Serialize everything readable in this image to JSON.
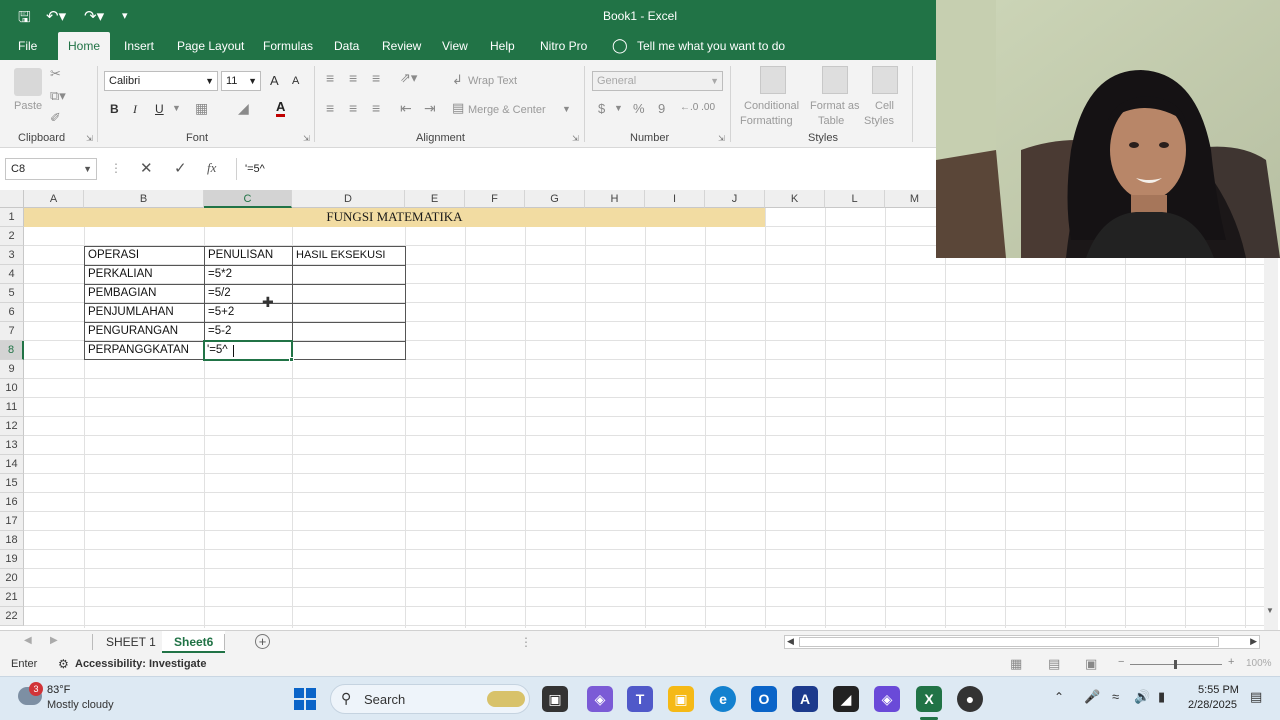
{
  "window": {
    "title": "Book1  -  Excel"
  },
  "ribbon_tabs": [
    "File",
    "Home",
    "Insert",
    "Page Layout",
    "Formulas",
    "Data",
    "Review",
    "View",
    "Help",
    "Nitro Pro"
  ],
  "active_tab": "Home",
  "tell_me": "Tell me what you want to do",
  "ribbon": {
    "clipboard": {
      "paste_label": "Paste",
      "group_label": "Clipboard"
    },
    "font": {
      "name": "Calibri",
      "size": "11",
      "grow": "A",
      "shrink": "A",
      "bold": "B",
      "italic": "I",
      "underline": "U",
      "color_letter": "A",
      "group_label": "Font"
    },
    "alignment": {
      "wrap_text": "Wrap Text",
      "merge_center": "Merge & Center",
      "group_label": "Alignment"
    },
    "number": {
      "format": "General",
      "currency": "$",
      "percent": "%",
      "comma": "9",
      "inc_decimal": "←.0 .00",
      "group_label": "Number"
    },
    "styles": {
      "conditional": "Conditional",
      "conditional2": "Formatting",
      "format_as": "Format as",
      "format_as2": "Table",
      "cell": "Cell",
      "cell2": "Styles",
      "group_label": "Styles"
    }
  },
  "formula_bar": {
    "name_box": "C8",
    "value": "'=5^"
  },
  "columns": [
    "A",
    "B",
    "C",
    "D",
    "E",
    "F",
    "G",
    "H",
    "I",
    "J",
    "K",
    "L",
    "M"
  ],
  "rows": [
    "1",
    "2",
    "3",
    "4",
    "5",
    "6",
    "7",
    "8",
    "9",
    "10",
    "11",
    "12",
    "13",
    "14",
    "15",
    "16",
    "17",
    "18",
    "19",
    "20",
    "21",
    "22"
  ],
  "sheet": {
    "title": "FUNGSI MATEMATIKA",
    "headers": [
      "OPERASI",
      "PENULISAN",
      "HASIL EKSEKUSI"
    ],
    "table": [
      [
        "PERKALIAN",
        "=5*2"
      ],
      [
        "PEMBAGIAN",
        "=5/2"
      ],
      [
        "PENJUMLAHAN",
        "=5+2"
      ],
      [
        "PENGURANGAN",
        "=5-2"
      ],
      [
        "PERPANGGKATAN",
        "'=5^"
      ]
    ]
  },
  "sheet_tabs": [
    "SHEET 1",
    "Sheet6"
  ],
  "active_sheet": "Sheet6",
  "status": {
    "mode": "Enter",
    "accessibility": "Accessibility: Investigate",
    "zoom": "100%"
  },
  "taskbar": {
    "weather_temp": "83°F",
    "weather_desc": "Mostly cloudy",
    "weather_badge": "3",
    "search_placeholder": "Search",
    "time": "5:55 PM",
    "date": "2/28/2025"
  },
  "colors": {
    "excel_green": "#217346",
    "title_fill": "#f2dca2",
    "ribbon_bg": "#f3f3f3",
    "taskbar_bg": "#dde9f3"
  }
}
